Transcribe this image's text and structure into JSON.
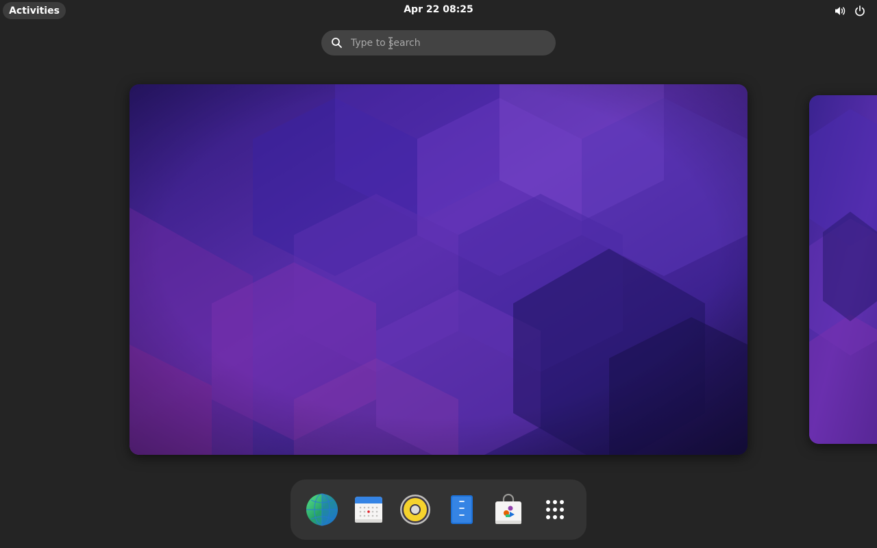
{
  "topbar": {
    "activities_label": "Activities",
    "clock": "Apr 22  08:25",
    "volume_icon": "volume-high-icon",
    "power_icon": "power-icon"
  },
  "search": {
    "placeholder": "Type to search",
    "value": "",
    "icon": "search-icon"
  },
  "workspaces": [
    {
      "name": "workspace-1",
      "active": true
    },
    {
      "name": "workspace-2",
      "active": false
    }
  ],
  "dock": {
    "items": [
      {
        "name": "web-browser",
        "icon": "globe-icon"
      },
      {
        "name": "calendar",
        "icon": "calendar-icon"
      },
      {
        "name": "rhythmbox",
        "icon": "speaker-icon"
      },
      {
        "name": "text-editor",
        "icon": "document-icon"
      },
      {
        "name": "software",
        "icon": "shopping-bag-icon"
      },
      {
        "name": "show-apps",
        "icon": "app-grid-icon"
      }
    ]
  },
  "colors": {
    "background": "#242424",
    "panel": "#333333",
    "search_bg": "#434343",
    "wallpaper_base": "#4a2a9a",
    "accent_blue": "#3584e4"
  }
}
